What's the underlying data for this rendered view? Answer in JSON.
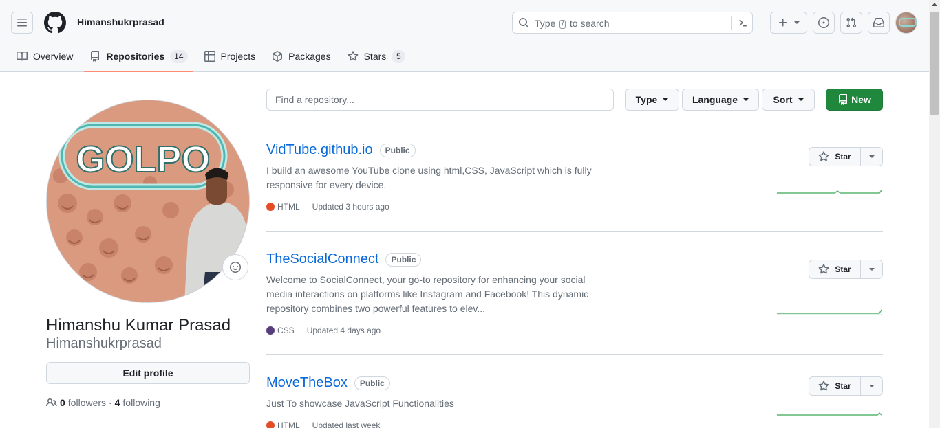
{
  "header": {
    "username": "Himanshukrprasad",
    "search": {
      "prefix": "Type",
      "key": "/",
      "suffix": "to search"
    }
  },
  "tabs": [
    {
      "label": "Overview",
      "icon": "book-icon"
    },
    {
      "label": "Repositories",
      "icon": "repo-icon",
      "count": "14"
    },
    {
      "label": "Projects",
      "icon": "table-icon"
    },
    {
      "label": "Packages",
      "icon": "package-icon"
    },
    {
      "label": "Stars",
      "icon": "star-icon",
      "count": "5"
    }
  ],
  "profile": {
    "full_name": "Himanshu Kumar Prasad",
    "login": "Himanshukrprasad",
    "edit_label": "Edit profile",
    "followers_count": "0",
    "followers_label": "followers",
    "following_count": "4",
    "following_label": "following",
    "avatar_sign_text": "GOLPO"
  },
  "repo_toolbar": {
    "find_placeholder": "Find a repository...",
    "type_label": "Type",
    "language_label": "Language",
    "sort_label": "Sort",
    "new_label": "New"
  },
  "repos": [
    {
      "name": "VidTube.github.io",
      "visibility": "Public",
      "description": "I build an awesome YouTube clone using html,CSS, JavaScript which is fully responsive for every device.",
      "language": "HTML",
      "language_color": "#e34c26",
      "updated": "Updated 3 hours ago",
      "star_label": "Star"
    },
    {
      "name": "TheSocialConnect",
      "visibility": "Public",
      "description": "Welcome to SocialConnect, your go-to repository for enhancing your social media interactions on platforms like Instagram and Facebook! This dynamic repository combines two powerful features to elev...",
      "language": "CSS",
      "language_color": "#563d7c",
      "updated": "Updated 4 days ago",
      "star_label": "Star"
    },
    {
      "name": "MoveTheBox",
      "visibility": "Public",
      "description": "Just To showcase JavaScript Functionalities",
      "language": "HTML",
      "language_color": "#e34c26",
      "updated": "Updated last week",
      "star_label": "Star"
    }
  ],
  "colors": {
    "accent_link": "#0969da",
    "new_button": "#1f883d",
    "active_tab_underline": "#fd8c73",
    "sparkline": "#2da44e"
  }
}
